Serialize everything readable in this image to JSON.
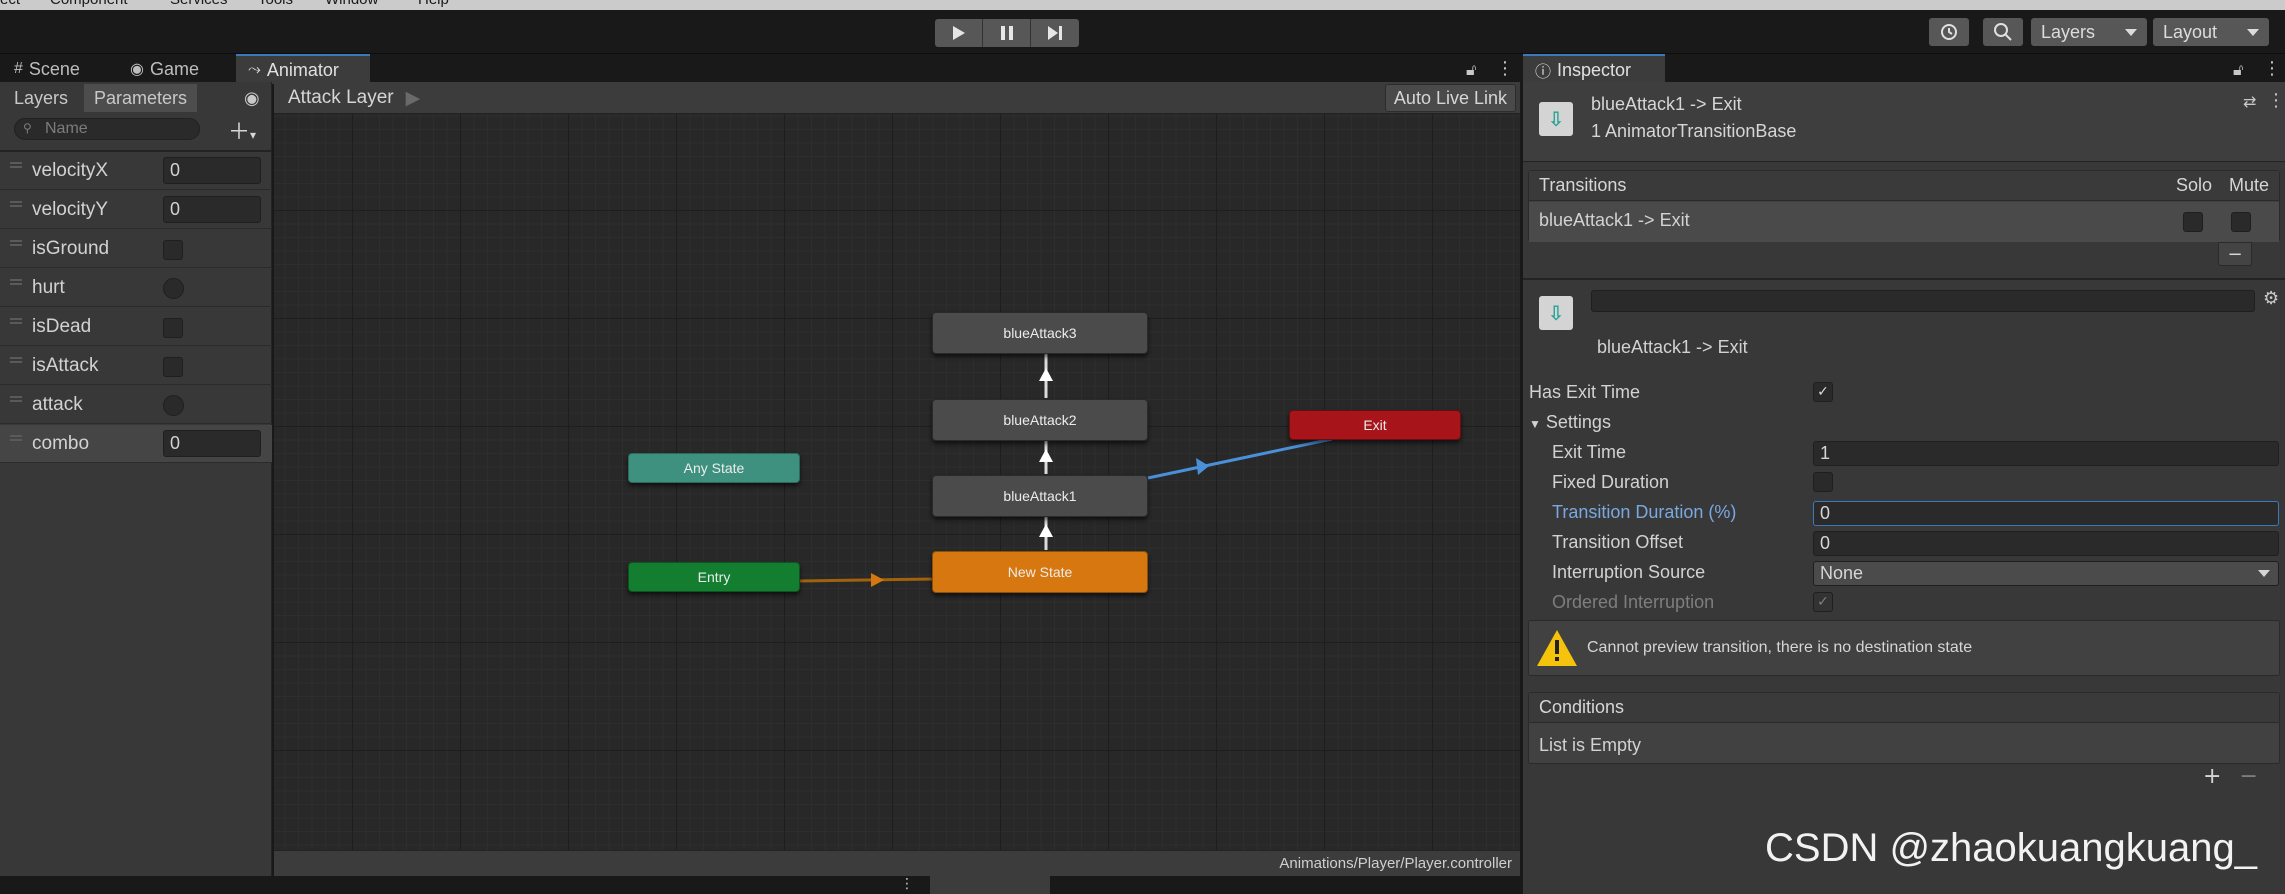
{
  "menu": [
    "ect",
    "Component",
    "Services",
    "Tools",
    "Window",
    "Help"
  ],
  "toolbar": {
    "play_icon": "play-icon",
    "pause_icon": "pause-icon",
    "step_icon": "step-icon",
    "layers_label": "Layers",
    "layout_label": "Layout"
  },
  "tabs": {
    "scene": "Scene",
    "game": "Game",
    "animator": "Animator",
    "inspector": "Inspector"
  },
  "animator": {
    "layers_tab": "Layers",
    "parameters_tab": "Parameters",
    "search_placeholder": "Name",
    "breadcrumb": "Attack Layer",
    "auto_live_link": "Auto Live Link",
    "path": "Animations/Player/Player.controller",
    "parameters": [
      {
        "name": "velocityX",
        "type": "float",
        "value": "0"
      },
      {
        "name": "velocityY",
        "type": "float",
        "value": "0"
      },
      {
        "name": "isGround",
        "type": "bool",
        "value": ""
      },
      {
        "name": "hurt",
        "type": "trigger",
        "value": ""
      },
      {
        "name": "isDead",
        "type": "bool",
        "value": ""
      },
      {
        "name": "isAttack",
        "type": "bool",
        "value": ""
      },
      {
        "name": "attack",
        "type": "trigger",
        "value": ""
      },
      {
        "name": "combo",
        "type": "int",
        "value": "0"
      }
    ],
    "nodes": {
      "blueAttack3": "blueAttack3",
      "blueAttack2": "blueAttack2",
      "blueAttack1": "blueAttack1",
      "new_state": "New State",
      "exit": "Exit",
      "any_state": "Any State",
      "entry": "Entry"
    }
  },
  "inspector": {
    "title": "blueAttack1 -> Exit",
    "subtitle": "1 AnimatorTransitionBase",
    "transitions_header": "Transitions",
    "solo": "Solo",
    "mute": "Mute",
    "transition_row": "blueAttack1 -> Exit",
    "minus": "−",
    "transition_name": "blueAttack1 -> Exit",
    "has_exit_time_label": "Has Exit Time",
    "has_exit_time_checked": "✓",
    "settings_label": "Settings",
    "exit_time_label": "Exit Time",
    "exit_time_value": "1",
    "fixed_duration_label": "Fixed Duration",
    "transition_duration_label": "Transition Duration (%)",
    "transition_duration_value": "0",
    "transition_offset_label": "Transition Offset",
    "transition_offset_value": "0",
    "interruption_source_label": "Interruption Source",
    "interruption_source_value": "None",
    "ordered_interruption_label": "Ordered Interruption",
    "ordered_interruption_checked": "✓",
    "warning": "Cannot preview transition, there is no destination state",
    "conditions_header": "Conditions",
    "conditions_empty": "List is Empty",
    "plus": "+",
    "minus2": "−"
  },
  "watermark": "CSDN @zhaokuangkuang_",
  "colors": {
    "accent": "#3a79bb",
    "exit_node": "#a7141a",
    "entry_node": "#137e30",
    "any_state_node": "#3d917e",
    "default_state": "#d6780f",
    "transition_selected": "#4a90d9",
    "transition_entry": "#a0620c"
  }
}
